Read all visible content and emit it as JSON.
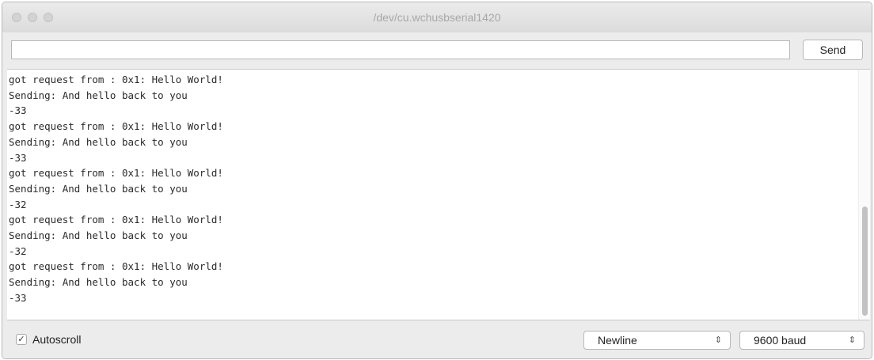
{
  "window": {
    "title": "/dev/cu.wchusbserial1420"
  },
  "input": {
    "value": "",
    "placeholder": "",
    "send_label": "Send"
  },
  "output": {
    "lines": [
      "got request from : 0x1: Hello World!",
      "Sending: And hello back to you",
      "-33",
      "got request from : 0x1: Hello World!",
      "Sending: And hello back to you",
      "-33",
      "got request from : 0x1: Hello World!",
      "Sending: And hello back to you",
      "-32",
      "got request from : 0x1: Hello World!",
      "Sending: And hello back to you",
      "-32",
      "got request from : 0x1: Hello World!",
      "Sending: And hello back to you",
      "-33"
    ]
  },
  "footer": {
    "autoscroll_label": "Autoscroll",
    "autoscroll_checked": true,
    "checkmark": "✓",
    "line_ending": "Newline",
    "baud_rate": "9600 baud",
    "updown_glyph": "⇕"
  },
  "icons": {
    "close": "close-button-icon",
    "minimize": "minimize-button-icon",
    "zoom": "zoom-button-icon",
    "select_arrows": "updown-chevron-icon",
    "checkbox": "checkmark-icon"
  }
}
